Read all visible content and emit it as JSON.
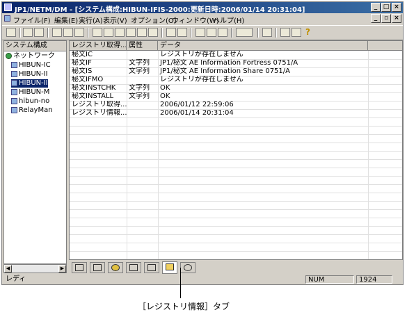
{
  "window": {
    "title": "JP1/NETM/DM - [システム構成:HIBUN-IFIS-2000:更新日時:2006/01/14 20:31:04]"
  },
  "menu": {
    "items": [
      "ファイル(F)",
      "編集(E)",
      "実行(A)",
      "表示(V)",
      "オプション(O)",
      "ウィンドウ(W)",
      "ヘルプ(H)"
    ]
  },
  "tree": {
    "header": "システム構成",
    "root": "ネットワーク",
    "items": [
      "HIBUN-IC",
      "HIBUN-II",
      "HIBUN-II",
      "HIBUN-M",
      "hibun-no",
      "RelayMan"
    ]
  },
  "table": {
    "columns": [
      "レジストリ取得...",
      "属性",
      "データ"
    ],
    "rows": [
      [
        "秘文IC",
        "",
        "レジストリが存在しません"
      ],
      [
        "秘文IF",
        "文字列",
        "JP1/秘文 AE Information Fortress 0751/A"
      ],
      [
        "秘文IS",
        "文字列",
        "JP1/秘文 AE Information Share 0751/A"
      ],
      [
        "秘文IFMO",
        "",
        "レジストリが存在しません"
      ],
      [
        "秘文INSTCHK",
        "文字列",
        "OK"
      ],
      [
        "秘文INSTALL",
        "文字列",
        "OK"
      ],
      [
        "レジストリ取得...",
        "",
        "2006/01/12 22:59:06"
      ],
      [
        "レジストリ情報...",
        "",
        "2006/01/14 20:31:04"
      ]
    ]
  },
  "status": {
    "left": "レディ",
    "num": "NUM",
    "resolution": "1924"
  },
  "caption": "［レジストリ情報］タブ",
  "colors": {
    "titlebar": "#0a246a",
    "selection": "#0a246a",
    "chrome": "#d4d0c8"
  }
}
